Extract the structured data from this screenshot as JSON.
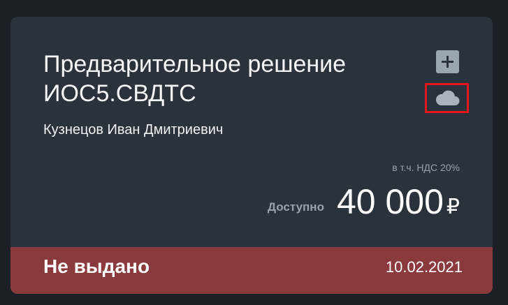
{
  "card": {
    "title": "Предварительное решение ИОС5.СВДТС",
    "person": "Кузнецов Иван Дмитриевич",
    "vat_note": "в т.ч. НДС 20%",
    "available_label": "Доступно",
    "amount": "40 000",
    "currency": "₽",
    "actions": {
      "add_icon": "plus-icon",
      "cloud_icon": "cloud-icon"
    }
  },
  "status": {
    "label": "Не выдано",
    "date": "10.02.2021"
  },
  "colors": {
    "background": "#1b2026",
    "card": "#2a323b",
    "status_bar": "#8a3a3d",
    "highlight_border": "#e8141b"
  }
}
